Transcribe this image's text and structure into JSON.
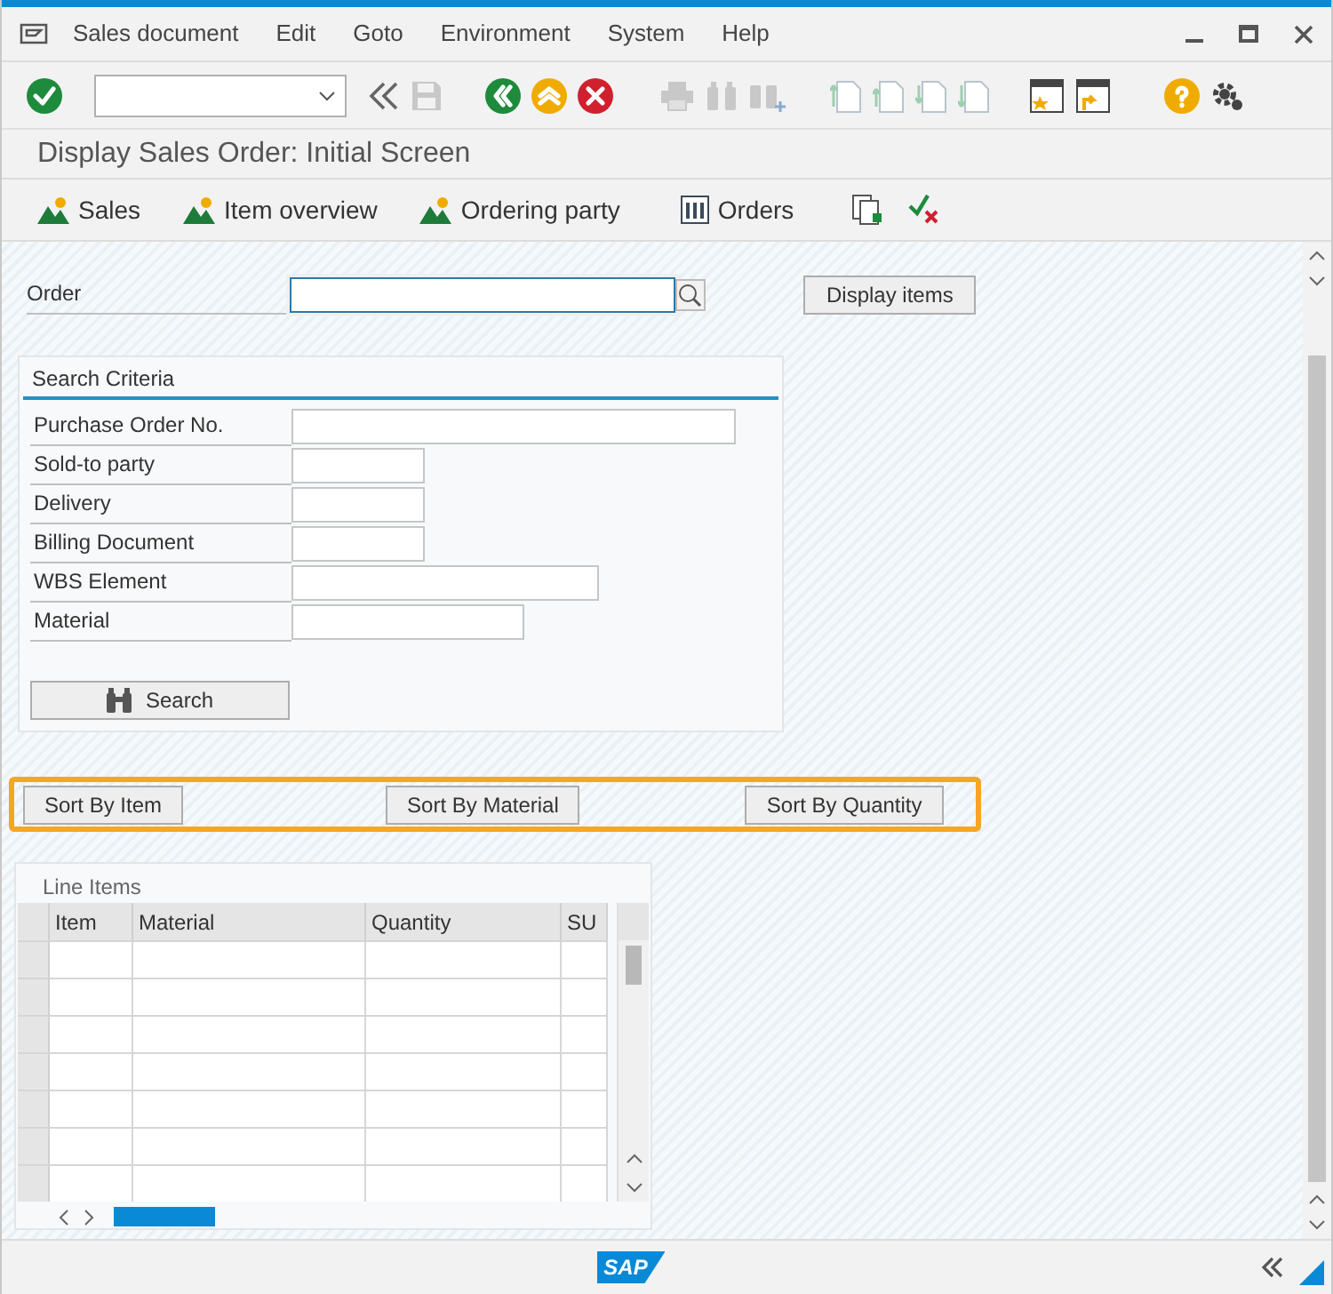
{
  "menu": [
    "Sales document",
    "Edit",
    "Goto",
    "Environment",
    "System",
    "Help"
  ],
  "title": "Display Sales Order: Initial Screen",
  "app_toolbar": [
    {
      "label": "Sales",
      "kind": "mountain"
    },
    {
      "label": "Item overview",
      "kind": "mountain"
    },
    {
      "label": "Ordering party",
      "kind": "mountain"
    },
    {
      "label": "Orders",
      "kind": "table"
    }
  ],
  "order": {
    "label": "Order",
    "button": "Display items"
  },
  "search_criteria": {
    "title": "Search Criteria",
    "fields": [
      {
        "label": "Purchase Order No."
      },
      {
        "label": "Sold-to party"
      },
      {
        "label": "Delivery"
      },
      {
        "label": "Billing Document"
      },
      {
        "label": "WBS Element"
      },
      {
        "label": "Material"
      }
    ],
    "button": "Search"
  },
  "sort_buttons": [
    "Sort By Item",
    "Sort By Material",
    "Sort By Quantity"
  ],
  "line_items": {
    "title": "Line Items",
    "columns": [
      "Item",
      "Material",
      "Quantity",
      "SU"
    ]
  },
  "footer": {
    "logo": "SAP"
  }
}
